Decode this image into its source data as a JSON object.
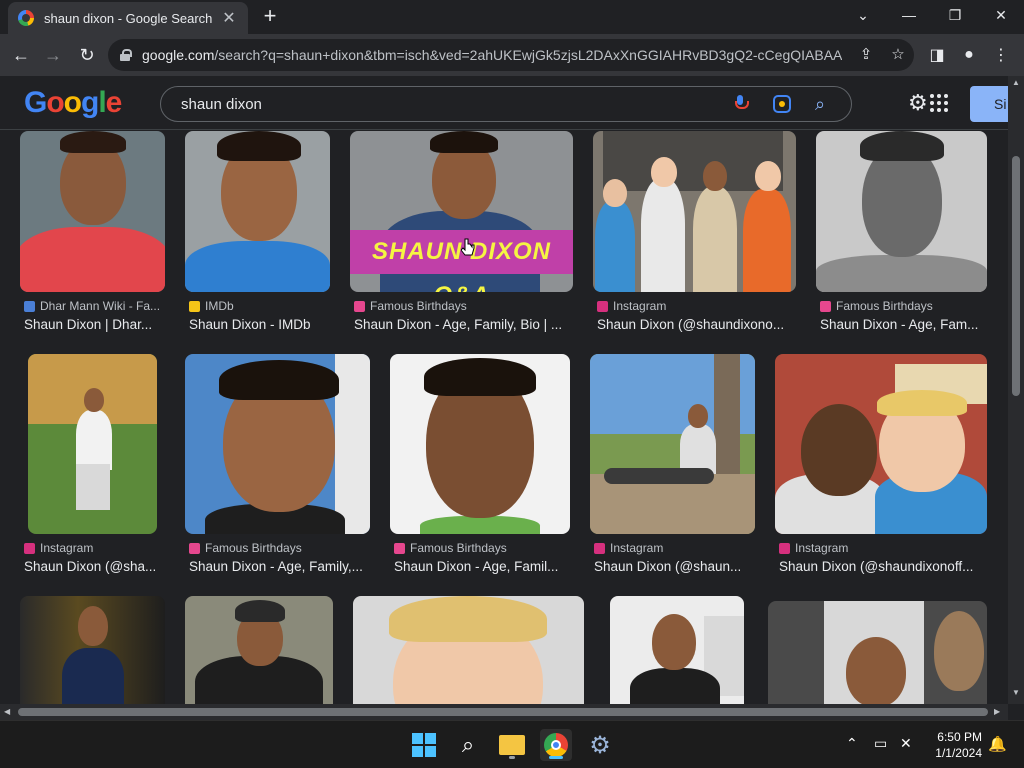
{
  "browser": {
    "tab_title": "shaun dixon - Google Search",
    "url_domain": "google.com",
    "url_rest": "/search?q=shaun+dixon&tbm=isch&ved=2ahUKEwjGk5zjsL2DAxXnGGIAHRvBD3gQ2-cCegQIABAA..."
  },
  "google": {
    "logo": [
      "G",
      "o",
      "o",
      "g",
      "l",
      "e"
    ],
    "logo_colors": [
      "#4285f4",
      "#ea4335",
      "#fbbc05",
      "#4285f4",
      "#34a853",
      "#ea4335"
    ],
    "query": "shaun dixon",
    "signin_label": "Si"
  },
  "results": [
    {
      "source": "Dhar Mann Wiki - Fa...",
      "title": "Shaun Dixon | Dhar...",
      "icon": "#4a7fd6"
    },
    {
      "source": "IMDb",
      "title": "Shaun Dixon - IMDb",
      "icon": "#f5c518"
    },
    {
      "source": "Famous Birthdays",
      "title": "Shaun Dixon - Age, Family, Bio | ...",
      "icon": "#e6478e",
      "overlay": "SHAUN DIXON Q&A"
    },
    {
      "source": "Instagram",
      "title": "Shaun Dixon (@shaundixono...",
      "icon": "#d6307e"
    },
    {
      "source": "Famous Birthdays",
      "title": "Shaun Dixon - Age, Fam...",
      "icon": "#e6478e"
    },
    {
      "source": "Instagram",
      "title": "Shaun Dixon (@sha...",
      "icon": "#d6307e"
    },
    {
      "source": "Famous Birthdays",
      "title": "Shaun Dixon - Age, Family,...",
      "icon": "#e6478e"
    },
    {
      "source": "Famous Birthdays",
      "title": "Shaun Dixon - Age, Famil...",
      "icon": "#e6478e"
    },
    {
      "source": "Instagram",
      "title": "Shaun Dixon (@shaun...",
      "icon": "#d6307e"
    },
    {
      "source": "Instagram",
      "title": "Shaun Dixon (@shaundixonoff...",
      "icon": "#d6307e"
    }
  ],
  "taskbar": {
    "time": "6:50 PM",
    "date": "1/1/2024"
  }
}
